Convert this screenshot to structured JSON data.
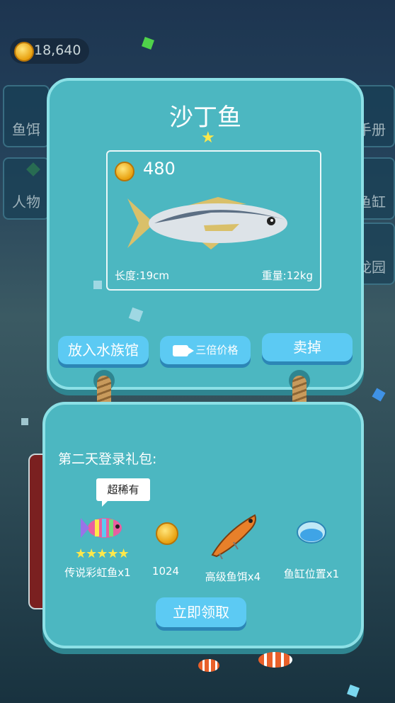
{
  "coins": "18,640",
  "side_left": [
    "鱼饵",
    "人物"
  ],
  "side_right": [
    "手册",
    "鱼缸",
    "龙园"
  ],
  "fish_card": {
    "title": "沙丁鱼",
    "price": "480",
    "length": "长度:19cm",
    "weight": "重量:12kg",
    "btn_aquarium": "放入水族馆",
    "btn_triple": "三倍价格",
    "btn_sell": "卖掉"
  },
  "gift_card": {
    "title": "第二天登录礼包:",
    "tooltip": "超稀有",
    "rewards": [
      {
        "label": "传说彩虹鱼x1",
        "stars": "★★★★★"
      },
      {
        "label": "1024"
      },
      {
        "label": "高级鱼饵x4"
      },
      {
        "label": "鱼缸位置x1"
      }
    ],
    "claim": "立即领取"
  },
  "colors": {
    "panel": "#4cb7c1",
    "button": "#5ccaf3",
    "star": "#ffe84a"
  }
}
